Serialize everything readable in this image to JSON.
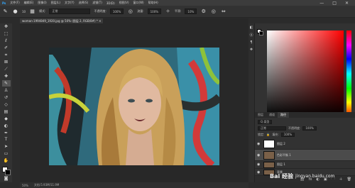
{
  "menu": {
    "items": [
      "文件(F)",
      "编辑(E)",
      "图像(I)",
      "图层(L)",
      "文字(Y)",
      "选择(S)",
      "滤镜(T)",
      "3D(D)",
      "视图(V)",
      "窗口(W)",
      "帮助(H)"
    ],
    "window_controls": [
      "—",
      "□",
      "✕"
    ]
  },
  "options": {
    "brush_size": "10",
    "mode_label": "模式:",
    "mode_value": "正常",
    "opacity_label": "不透明度:",
    "opacity_value": "100%",
    "flow_label": "流量:",
    "flow_value": "100%",
    "smooth_label": "平滑:",
    "smooth_value": "10%"
  },
  "document": {
    "tab_title": "woman-1994849_1920.jpg @ 50% (图层 2, RGB/8#) *  ✕",
    "zoom": "50%",
    "doc_info": "文档:5.93M/11.9M"
  },
  "right_strip": [
    "◧",
    "Ⓐ",
    "¶",
    "❖"
  ],
  "panels": {
    "tabs": [
      "图层",
      "通道",
      "路径"
    ],
    "active_tab": "路径",
    "kind_label": "Q 类型",
    "blend_mode": "正常",
    "opacity_label": "不透明度:",
    "opacity_value": "100%",
    "lock_label": "锁定:",
    "fill_label": "填充:",
    "fill_value": "100%",
    "layers": [
      {
        "name": "图层 2",
        "thumb": "blank",
        "selected": false
      },
      {
        "name": "色彩平衡 1",
        "thumb": "photo",
        "selected": true
      },
      {
        "name": "图层 1",
        "thumb": "photo",
        "selected": false
      },
      {
        "name": "背景",
        "thumb": "photo",
        "selected": false
      }
    ],
    "bottom_icons": [
      "⛓",
      "fx",
      "◐",
      "▣",
      "🗀",
      "＋",
      "🗑"
    ]
  },
  "watermark": {
    "text": "jingyan.baidu.com",
    "brand": "Bai 经验"
  },
  "colors": {
    "accent": "#ff0000",
    "ui_bg": "#323232"
  }
}
